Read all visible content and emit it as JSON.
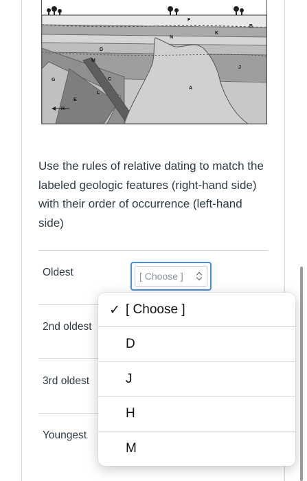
{
  "diagram": {
    "labels": [
      "F",
      "N",
      "K",
      "B",
      "D",
      "M",
      "C",
      "G",
      "L",
      "E",
      "H",
      "J",
      "A"
    ]
  },
  "question": {
    "instructions": "Use the rules of relative dating to match the labeled geologic features (right-hand side) with their order of occurrence (left-hand side)"
  },
  "rows": [
    {
      "label": "Oldest"
    },
    {
      "label": "2nd oldest"
    },
    {
      "label": "3rd oldest"
    },
    {
      "label": "Youngest"
    }
  ],
  "select": {
    "value": "[ Choose ]"
  },
  "dropdown": {
    "options": [
      {
        "label": "[ Choose ]",
        "check": "✓"
      },
      {
        "label": "D",
        "check": ""
      },
      {
        "label": "J",
        "check": ""
      },
      {
        "label": "H",
        "check": ""
      },
      {
        "label": "M",
        "check": ""
      }
    ]
  },
  "colors": {
    "accent": "#4a90d9",
    "text": "#2d3b45"
  },
  "icons": [
    "tree-icon",
    "chevron-updown-icon",
    "checkmark-icon"
  ]
}
